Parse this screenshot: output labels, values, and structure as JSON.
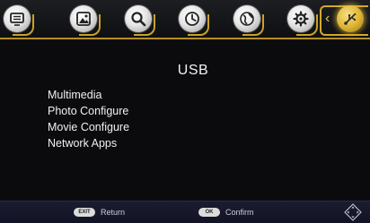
{
  "top_bar": {
    "tabs": [
      {
        "name": "media-tab",
        "icon": "screen-menu-icon"
      },
      {
        "name": "picture-tab",
        "icon": "picture-icon"
      },
      {
        "name": "search-tab",
        "icon": "search-icon"
      },
      {
        "name": "time-tab",
        "icon": "clock-icon"
      },
      {
        "name": "network-tab",
        "icon": "globe-icon"
      },
      {
        "name": "settings-tab",
        "icon": "gear-icon"
      },
      {
        "name": "usb-tab",
        "icon": "usb-icon",
        "selected": true
      }
    ],
    "accent_color": "#c9a227"
  },
  "main": {
    "title": "USB",
    "menu_items": [
      {
        "label": "Multimedia"
      },
      {
        "label": "Photo Configure"
      },
      {
        "label": "Movie Configure"
      },
      {
        "label": "Network Apps"
      }
    ]
  },
  "footer": {
    "return_key": "EXIT",
    "return_label": "Return",
    "confirm_key": "OK",
    "confirm_label": "Confirm"
  }
}
